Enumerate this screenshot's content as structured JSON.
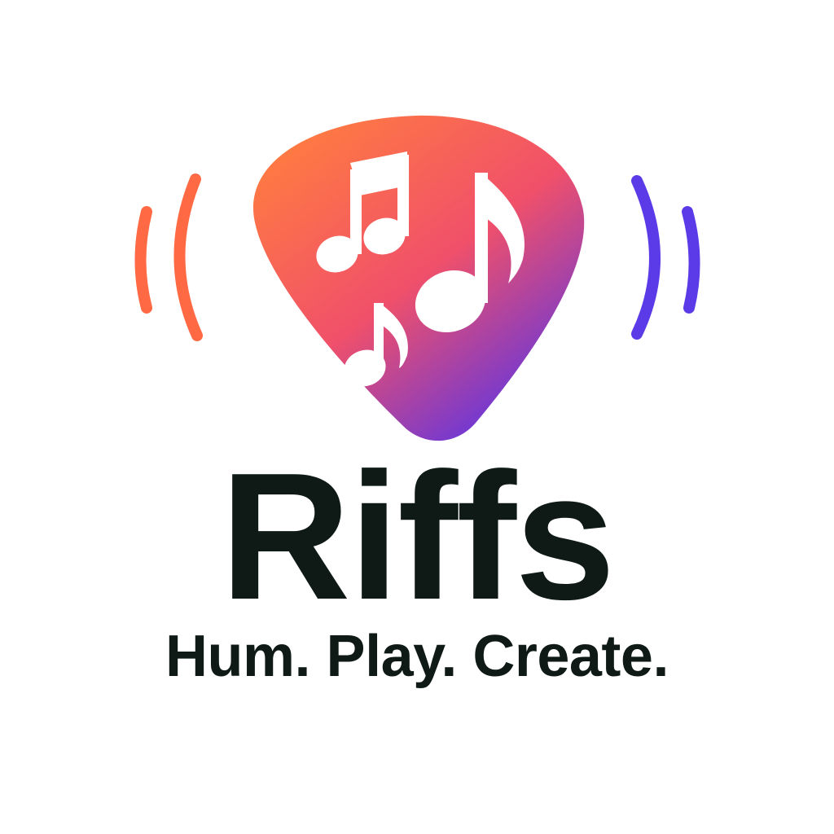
{
  "brand": {
    "name": "Riffs",
    "tagline": "Hum. Play. Create."
  },
  "icons": {
    "pick": "guitar-pick-icon",
    "notes": [
      "beamed-eighth-notes-icon",
      "eighth-note-icon",
      "small-eighth-note-icon"
    ],
    "waves_left": "sound-wave-left-icon",
    "waves_right": "sound-wave-right-icon"
  },
  "colors": {
    "gradient_start": "#ff6f45",
    "gradient_mid": "#f0506a",
    "gradient_end": "#5a34e6",
    "wave_left": "#ff6a45",
    "wave_right": "#5b3ae8",
    "text": "#0f1a17",
    "background": "#ffffff"
  }
}
